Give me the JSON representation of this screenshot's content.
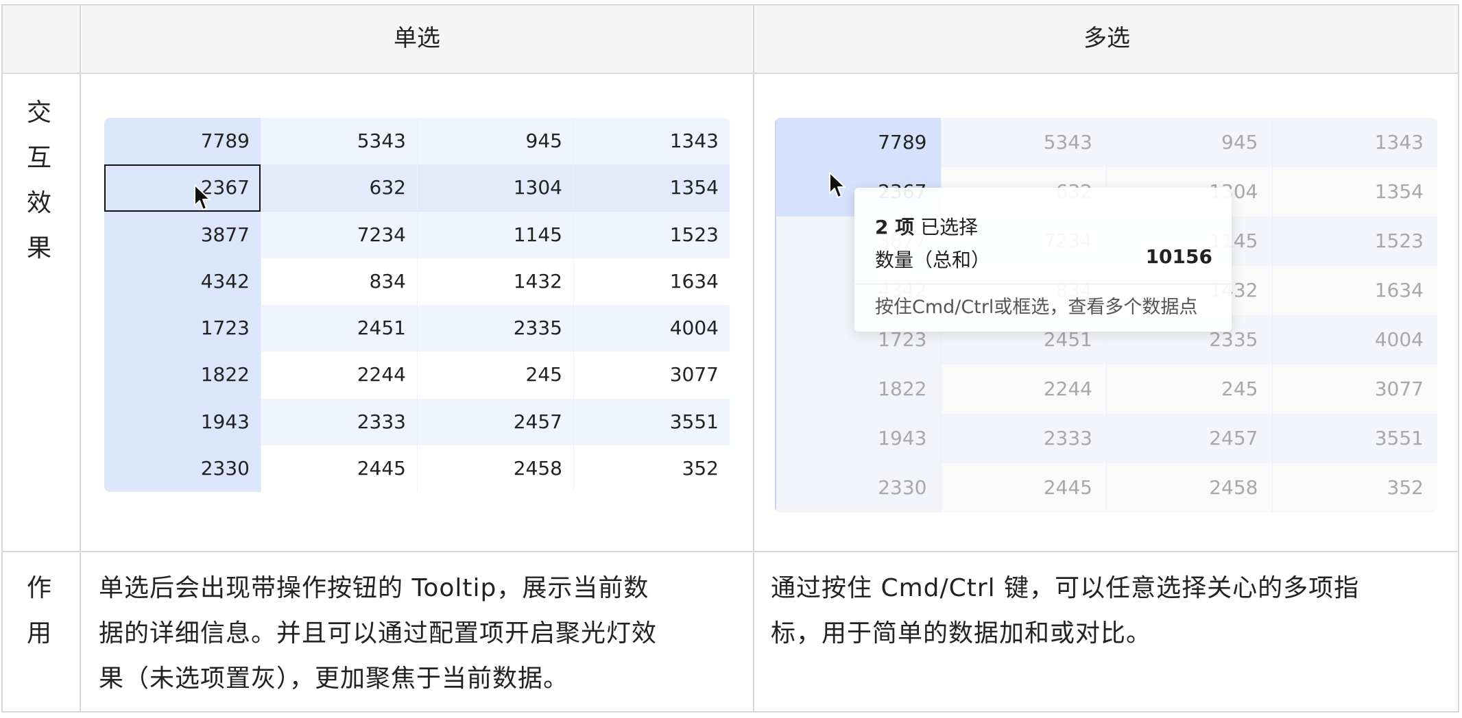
{
  "header": {
    "col_single": "单选",
    "col_multi": "多选"
  },
  "rows": {
    "interaction_label": [
      "交",
      "互",
      "效",
      "果"
    ],
    "purpose_label": [
      "作",
      "用"
    ]
  },
  "descriptions": {
    "single": [
      "单选后会出现带操作按钮的 Tooltip，展示当前数",
      "据的详细信息。并且可以通过配置项开启聚光灯效",
      "果（未选项置灰），更加聚焦于当前数据。"
    ],
    "multi": [
      "通过按住 Cmd/Ctrl 键，可以任意选择关心的多项指",
      "标，用于简单的数据加和或对比。"
    ]
  },
  "table_data": [
    [
      "7789",
      "5343",
      "945",
      "1343"
    ],
    [
      "2367",
      "632",
      "1304",
      "1354"
    ],
    [
      "3877",
      "7234",
      "1145",
      "1523"
    ],
    [
      "4342",
      "834",
      "1432",
      "1634"
    ],
    [
      "1723",
      "2451",
      "2335",
      "4004"
    ],
    [
      "1822",
      "2244",
      "245",
      "3077"
    ],
    [
      "1943",
      "2333",
      "2457",
      "3551"
    ],
    [
      "2330",
      "2445",
      "2458",
      "352"
    ]
  ],
  "single_selected": {
    "row": 1,
    "col": 0
  },
  "tooltip": {
    "count": "2 项",
    "selected_text": "已选择",
    "metric": "数量（总和）",
    "value": "10156",
    "hint": "按住Cmd/Ctrl或框选，查看多个数据点"
  },
  "colors": {
    "border": "#d8d8d8",
    "header_bg": "#f5f5f5",
    "first_col": "#dce6fb",
    "row_stripe": "#f0f4fe",
    "row_highlight": "#e4eafb"
  }
}
